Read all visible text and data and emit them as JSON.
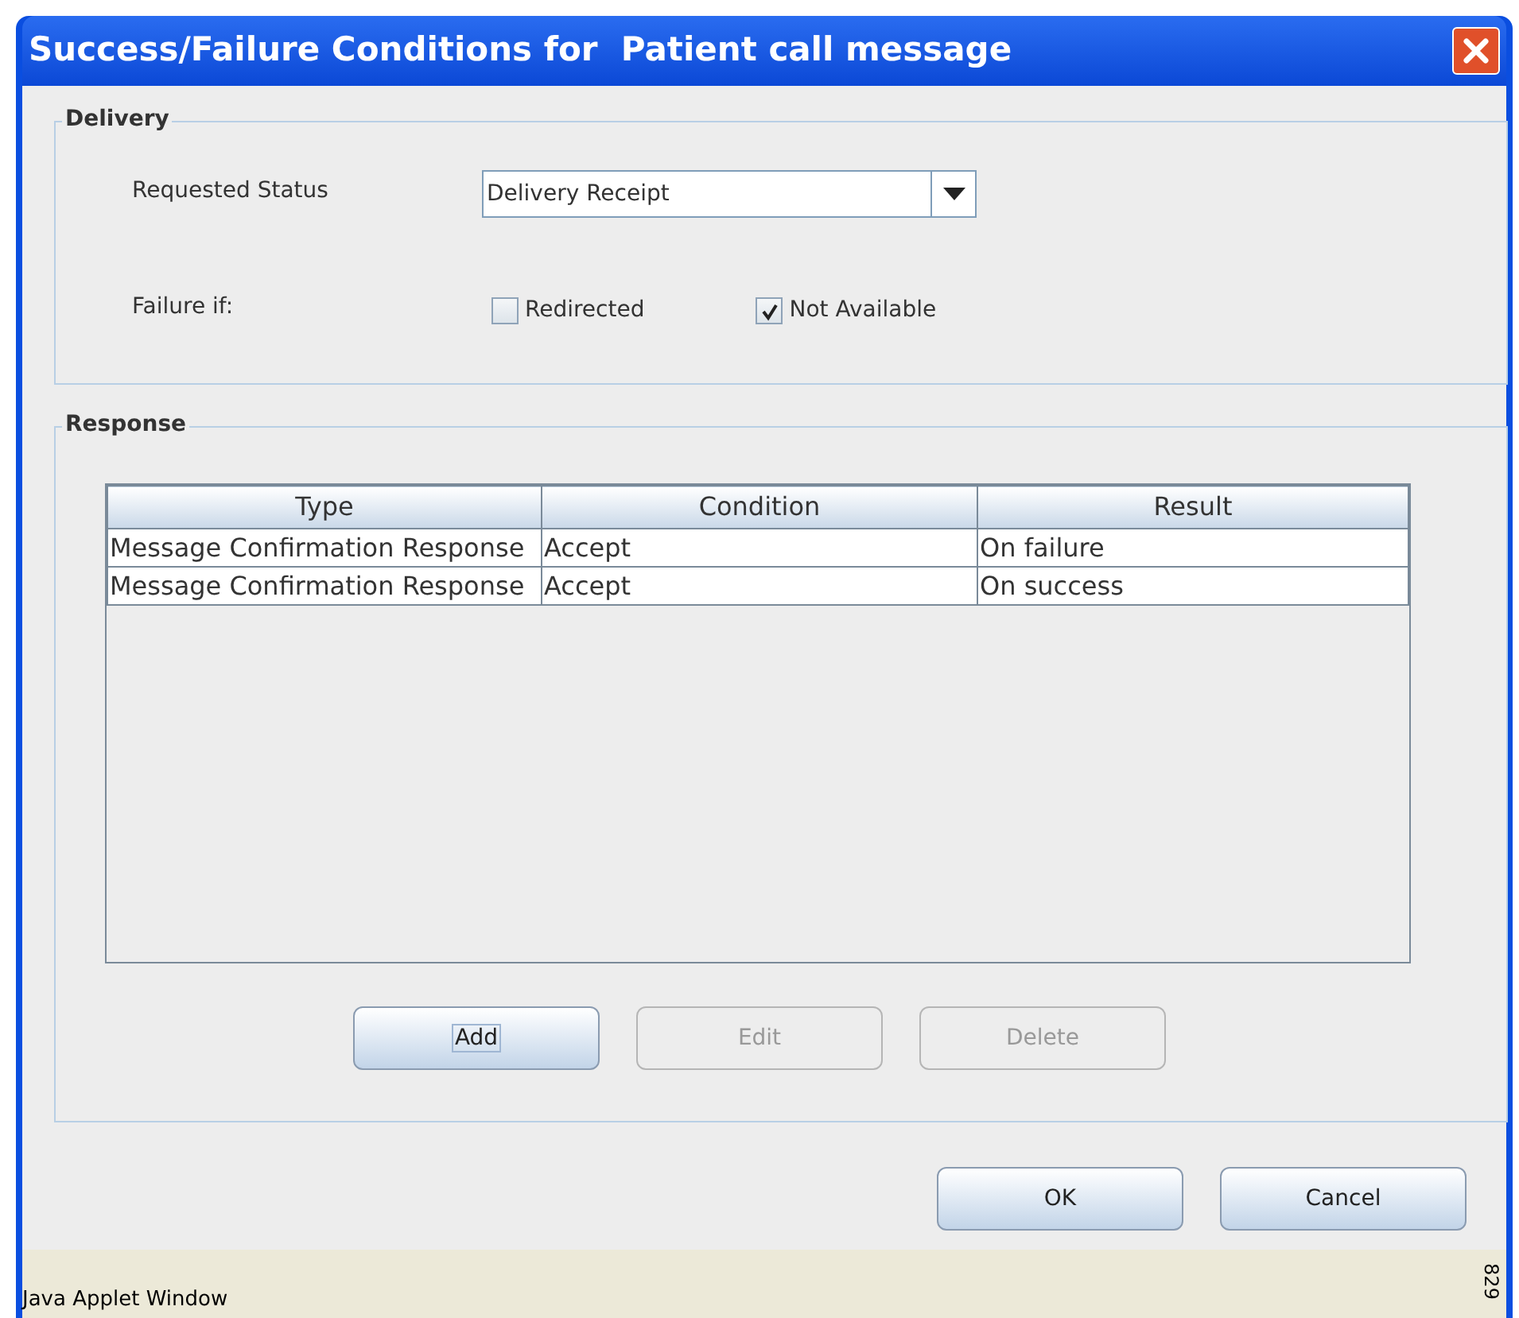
{
  "window": {
    "title": "Success/Failure Conditions for  Patient call message"
  },
  "delivery": {
    "legend": "Delivery",
    "requested_status_label": "Requested Status",
    "requested_status": {
      "value": "Delivery Receipt"
    },
    "failure_label": "Failure if:",
    "options": [
      {
        "label": "Redirected",
        "checked": false
      },
      {
        "label": "Not Available",
        "checked": true
      }
    ]
  },
  "response": {
    "legend": "Response",
    "table": {
      "columns": [
        "Type",
        "Condition",
        "Result"
      ],
      "rows": [
        [
          "Message Confirmation Response",
          "Accept",
          "On failure"
        ],
        [
          "Message Confirmation Response",
          "Accept",
          "On success"
        ]
      ]
    },
    "buttons": [
      {
        "label": "Add",
        "disabled": false,
        "focused": true
      },
      {
        "label": "Edit",
        "disabled": true,
        "focused": false
      },
      {
        "label": "Delete",
        "disabled": true,
        "focused": false
      }
    ]
  },
  "dialog_buttons": [
    "OK",
    "Cancel"
  ],
  "status_bar": {
    "text": "Java Applet Window",
    "figure_number": "829"
  }
}
